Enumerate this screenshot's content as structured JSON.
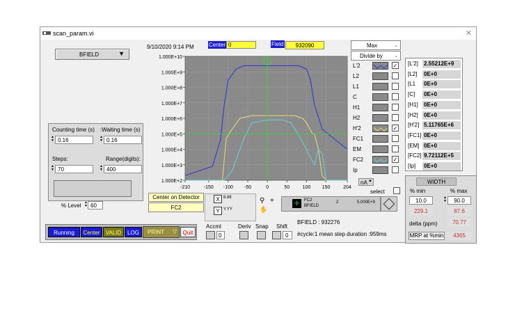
{
  "window": {
    "title": "scan_param.vi"
  },
  "top": {
    "datetime": "9/10/2020  9:14 PM",
    "center_label": "Center",
    "center_value": "0",
    "field_label": "Field",
    "field_value": "932090",
    "max_select": "Max",
    "divide_select": "Divide by"
  },
  "left": {
    "parameter_select": "BFIELD",
    "counting_label": "Counting time (s)",
    "waiting_label": ":Waiting time (s)",
    "counting_value": "0.16",
    "waiting_value": "0.16",
    "steps_label": "Steps:",
    "range_label": "Range(digits):",
    "steps_value": "70",
    "range_value": "400",
    "level_label": "% Level",
    "level_value": "60"
  },
  "chart_data": {
    "type": "line",
    "yscale": "log",
    "ylim": [
      100,
      10000000000
    ],
    "xlim": [
      -210,
      204
    ],
    "yticks": [
      "1.000E+10",
      "1.000E+9",
      "1.000E+8",
      "1.000E+7",
      "1.000E+6",
      "1.000E+5",
      "1.000E+4",
      "1.000E+3",
      "1.000E+2"
    ],
    "xticks": [
      "-210",
      "-150",
      "-100",
      "-50",
      "0",
      "50",
      "100",
      "150",
      "204"
    ],
    "cursor_x": 0,
    "series": [
      {
        "name": "L'2",
        "color": "#2f2fd8",
        "x": [
          -210,
          -140,
          -120,
          -110,
          -100,
          -80,
          -60,
          -40,
          -20,
          0,
          20,
          40,
          60,
          80,
          100,
          110,
          120,
          140,
          204
        ],
        "y": [
          200,
          800,
          40000,
          8000000,
          300000000,
          1500000000,
          2500000000,
          2500000000,
          2500000000,
          2500000000,
          2500000000,
          2500000000,
          2500000000,
          2500000000,
          1500000000,
          300000000,
          8000000,
          200000,
          10000
        ]
      },
      {
        "name": "H'2",
        "color": "#e8e070",
        "x": [
          -210,
          -120,
          -115,
          -105,
          -90,
          -70,
          -40,
          0,
          40,
          70,
          90,
          100,
          105,
          115,
          120,
          130,
          140,
          150,
          204
        ],
        "y": [
          100,
          100,
          100,
          50000,
          200000,
          1000000,
          1500000,
          1500000,
          1500000,
          1500000,
          1000000,
          500000,
          300000,
          100000,
          100000,
          10000,
          200,
          100,
          100
        ]
      },
      {
        "name": "FC2",
        "color": "#66d4d8",
        "x": [
          -210,
          -120,
          -110,
          -90,
          -60,
          -40,
          0,
          40,
          60,
          80,
          100,
          105,
          120,
          130,
          140,
          150,
          204
        ],
        "y": [
          100,
          100,
          100,
          400,
          50000,
          500000,
          800000,
          800000,
          500000,
          80000,
          10000,
          5000,
          1000,
          10000,
          5000,
          100,
          100
        ]
      }
    ]
  },
  "legend": {
    "items": [
      {
        "name": "L'2",
        "checked": "✓",
        "style": "blue"
      },
      {
        "name": "L2",
        "checked": "",
        "style": ""
      },
      {
        "name": "L1",
        "checked": "",
        "style": ""
      },
      {
        "name": "C",
        "checked": "",
        "style": ""
      },
      {
        "name": "H1",
        "checked": "",
        "style": ""
      },
      {
        "name": "H2",
        "checked": "",
        "style": ""
      },
      {
        "name": "H'2",
        "checked": "✓",
        "style": "yellow"
      },
      {
        "name": "FC1",
        "checked": "",
        "style": ""
      },
      {
        "name": "EM",
        "checked": "",
        "style": ""
      },
      {
        "name": "FC2",
        "checked": "✓",
        "style": "cyan"
      },
      {
        "name": "Ip",
        "checked": "",
        "style": ""
      }
    ],
    "unit_select": "nA",
    "select_label": "select"
  },
  "readings": [
    {
      "label": "[L'2]",
      "value": "2.55212E+9"
    },
    {
      "label": "[L2]",
      "value": "0E+0"
    },
    {
      "label": "[L1",
      "value": "0E+0"
    },
    {
      "label": "[C]",
      "value": "0E+0"
    },
    {
      "label": "[H1]",
      "value": "0E+0"
    },
    {
      "label": "[H2]",
      "value": "0E+0"
    },
    {
      "label": "[H'2]",
      "value": "5.11765E+6"
    },
    {
      "label": "[FC1]",
      "value": "0E+0"
    },
    {
      "label": "[EM]",
      "value": "0E+0"
    },
    {
      "label": "[FC2]",
      "value": "9.72112E+5"
    },
    {
      "label": "[Ip]",
      "value": "0E+0"
    }
  ],
  "width_panel": {
    "title": "WIDTH",
    "min_label": "% min",
    "max_label": "% max",
    "min_value": "10.0",
    "max_value": "90.0",
    "min_result": "229.1",
    "max_result": "87.6",
    "delta_label": "delta (ppm)",
    "delta_value": "70.77",
    "mrp_label": "MRP at %min",
    "mrp_value": "4365"
  },
  "bottom": {
    "center_on_detector": "Center on Detector",
    "detector_value": "FC2",
    "cursor_x_box": "8.88",
    "cursor_y_box": "Y.YY",
    "cursor_name": "FC2",
    "cursor_param": "BFIELD",
    "cursor_index": "2",
    "cursor_value": "5.000E+9",
    "accml_label": "Accml",
    "accml_value": "0",
    "deriv_label": "Deriv",
    "snap_label": "Snap",
    "shift_label": "Shift",
    "shift_value": "0",
    "bfield_status": "BFIELD : 932276",
    "cycle_status": "#cycle:1 mean step duration :959ms"
  },
  "statusbar": {
    "running": "Running",
    "center": "Center",
    "valid": "VALID",
    "log": "LOG",
    "print": "PRINT",
    "quit": "Quit"
  }
}
